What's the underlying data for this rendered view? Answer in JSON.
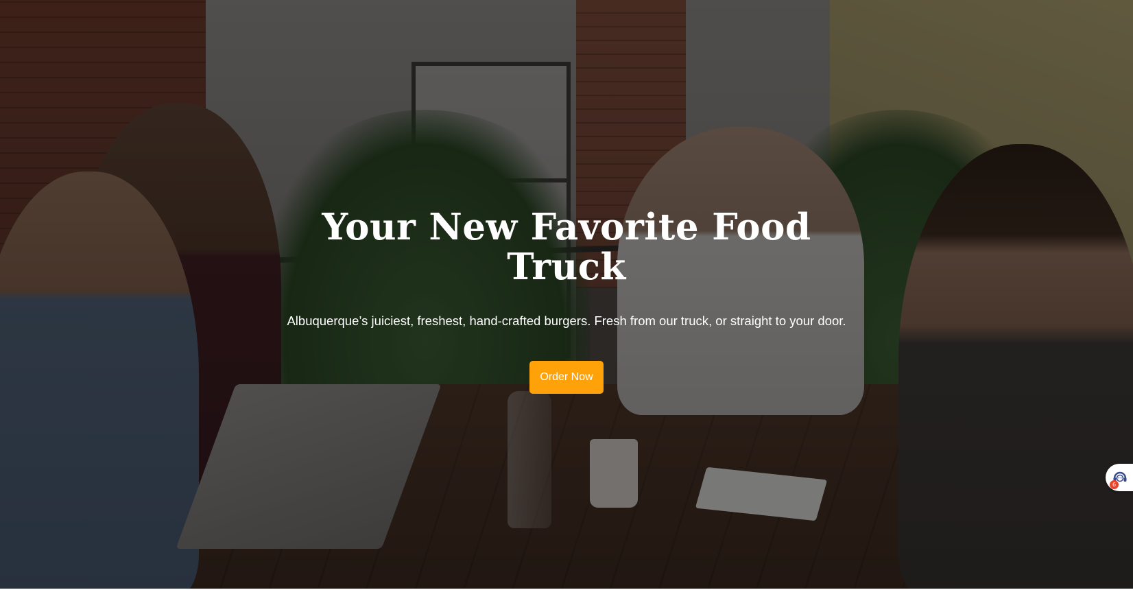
{
  "hero": {
    "title": "Your New Favorite Food Truck",
    "subtitle": "Albuquerque’s juiciest, freshest, hand-crafted burgers. Fresh from our truck, or straight to your door.",
    "cta_label": "Order Now",
    "background_image": "team-meeting-photo",
    "accent_color": "#ffa20a"
  },
  "support_widget": {
    "icon": "support-agent-icon",
    "badge_count": "6",
    "badge_color": "#e8432b"
  }
}
